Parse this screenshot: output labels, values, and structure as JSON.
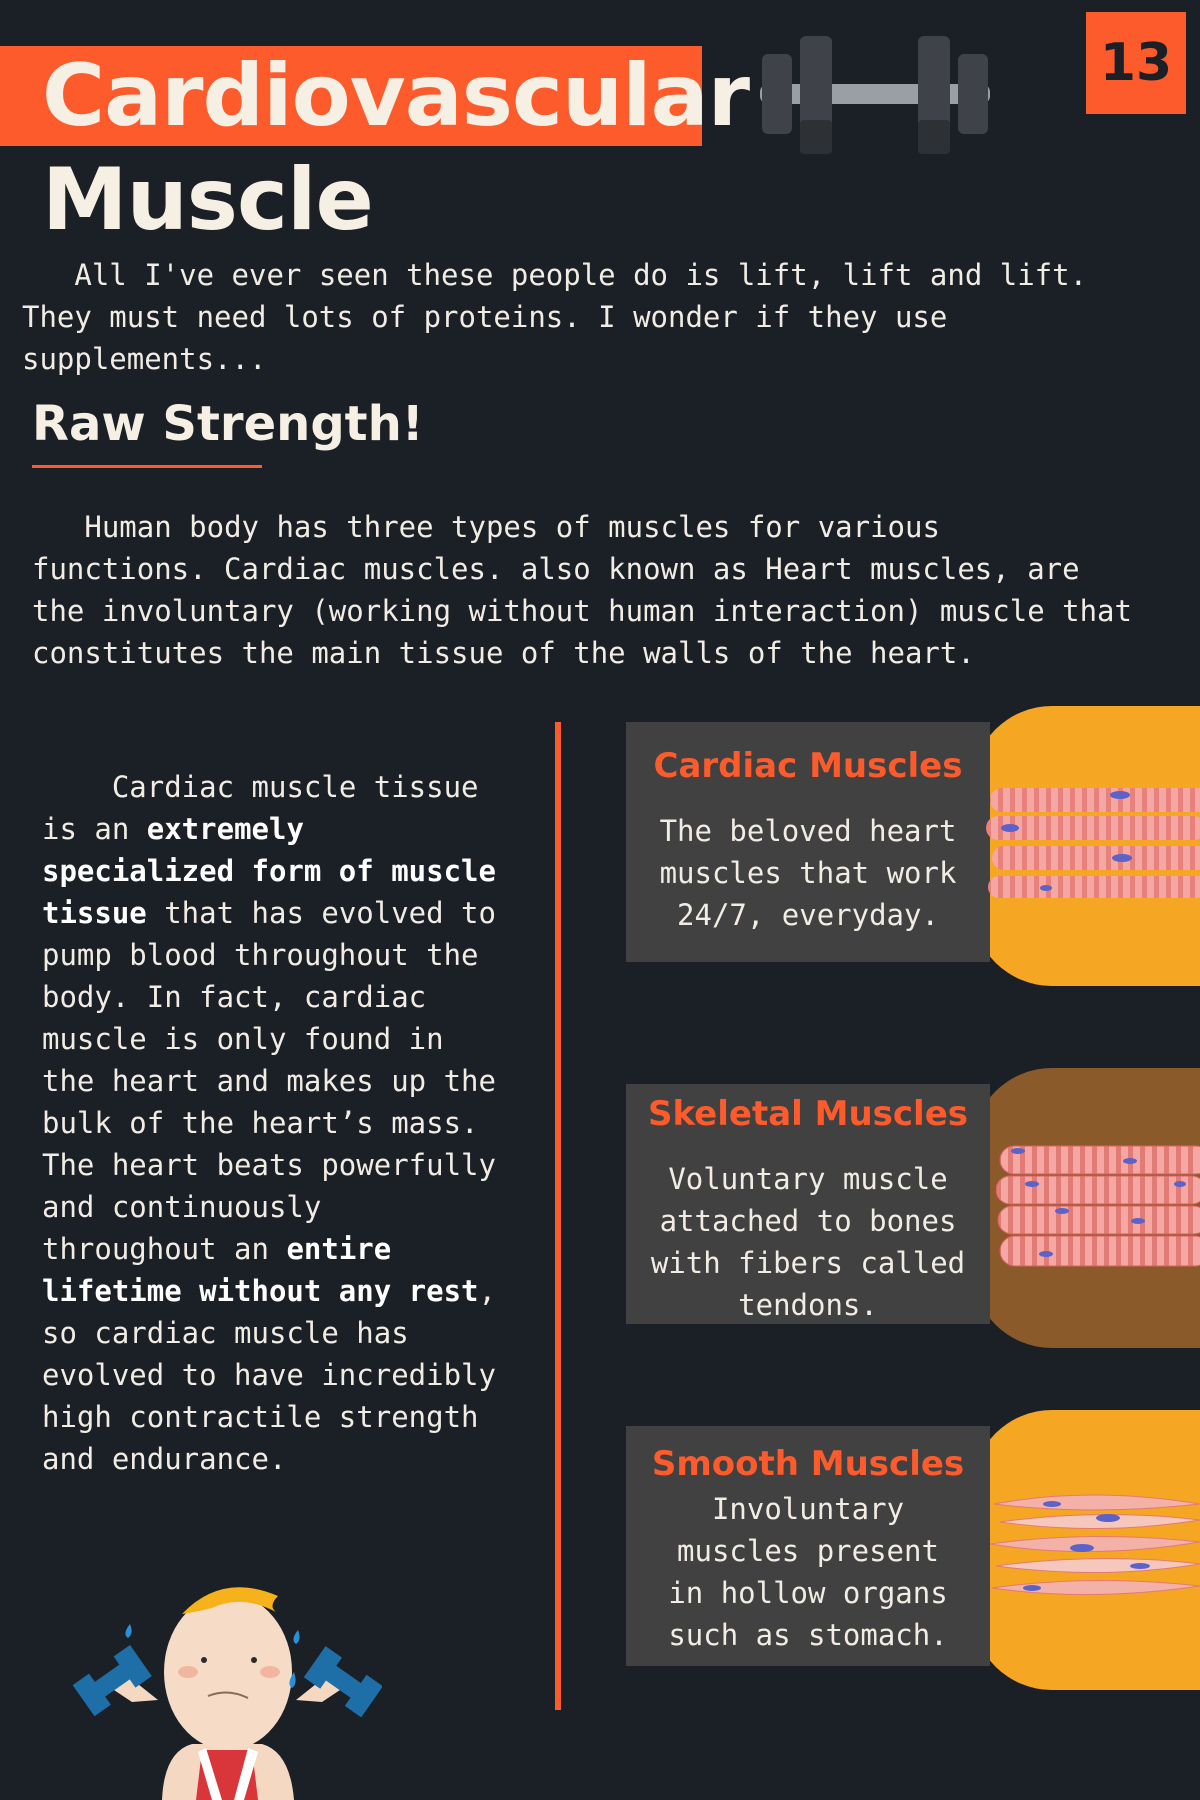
{
  "header": {
    "title_line1": "Cardiovascular",
    "title_line2": "Muscle",
    "page_number": "13",
    "icon": "dumbbell-icon"
  },
  "intro": {
    "text": "   All I've ever seen these people do is lift, lift and lift.\nThey must need lots of proteins. I wonder if they use\nsupplements..."
  },
  "section": {
    "heading": "Raw Strength!",
    "paragraph": "   Human body has three types of muscles for various\nfunctions. Cardiac muscles. also known as Heart muscles, are\nthe involuntary (working without human interaction) muscle that\nconstitutes the main tissue of the walls of the heart."
  },
  "cardiac_column": {
    "part1": "    Cardiac muscle tissue\nis an ",
    "bold1": "extremely\nspecialized form of muscle\ntissue",
    "part2": " that has evolved to\npump blood throughout the\nbody. In fact, cardiac\nmuscle is only found in\nthe heart and makes up the\nbulk of the heart’s mass.\nThe heart beats powerfully\nand continuously\nthroughout an ",
    "bold2": "entire\nlifetime without any rest",
    "part3": ",\nso cardiac muscle has\nevolved to have incredibly\nhigh contractile strength\nand endurance."
  },
  "muscle_types": [
    {
      "title": "Cardiac Muscles",
      "description": "The beloved heart\nmuscles that work\n24/7, everyday.",
      "background_color": "#f5a623",
      "icon": "cardiac-fiber-illustration"
    },
    {
      "title": "Skeletal Muscles",
      "description": "Voluntary muscle\nattached to bones\nwith fibers called\ntendons.",
      "background_color": "#8a5a2b",
      "icon": "skeletal-fiber-illustration"
    },
    {
      "title": "Smooth Muscles",
      "description": "Involuntary\nmuscles present\nin hollow organs\nsuch as stomach.",
      "background_color": "#f5a623",
      "icon": "smooth-fiber-illustration"
    }
  ],
  "colors": {
    "background": "#1b1f26",
    "accent": "#fe5b2c",
    "card_box": "#414141",
    "text": "#f1ece4"
  }
}
